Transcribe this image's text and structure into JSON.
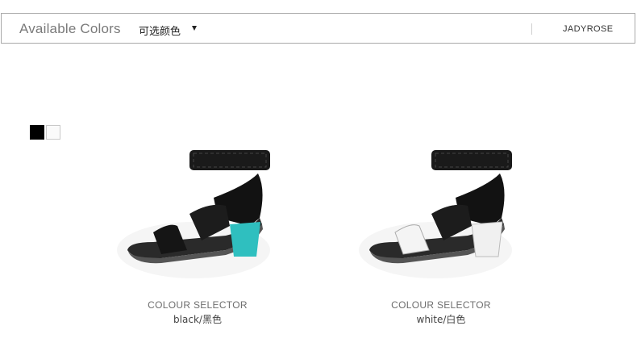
{
  "header": {
    "title": "Available Colors",
    "subtitle": "可选颜色",
    "brand": "JADYROSE"
  },
  "swatches": [
    {
      "color": "#000000"
    },
    {
      "color": "#fafafa"
    }
  ],
  "products": [
    {
      "selector_label": "COLOUR SELECTOR",
      "color_name": "black/黑色",
      "strap_color": "#111111",
      "heel_color": "#2fbfbf"
    },
    {
      "selector_label": "COLOUR SELECTOR",
      "color_name": "white/白色",
      "strap_color": "#f2f2f2",
      "heel_color": "#f0f0f0"
    }
  ]
}
